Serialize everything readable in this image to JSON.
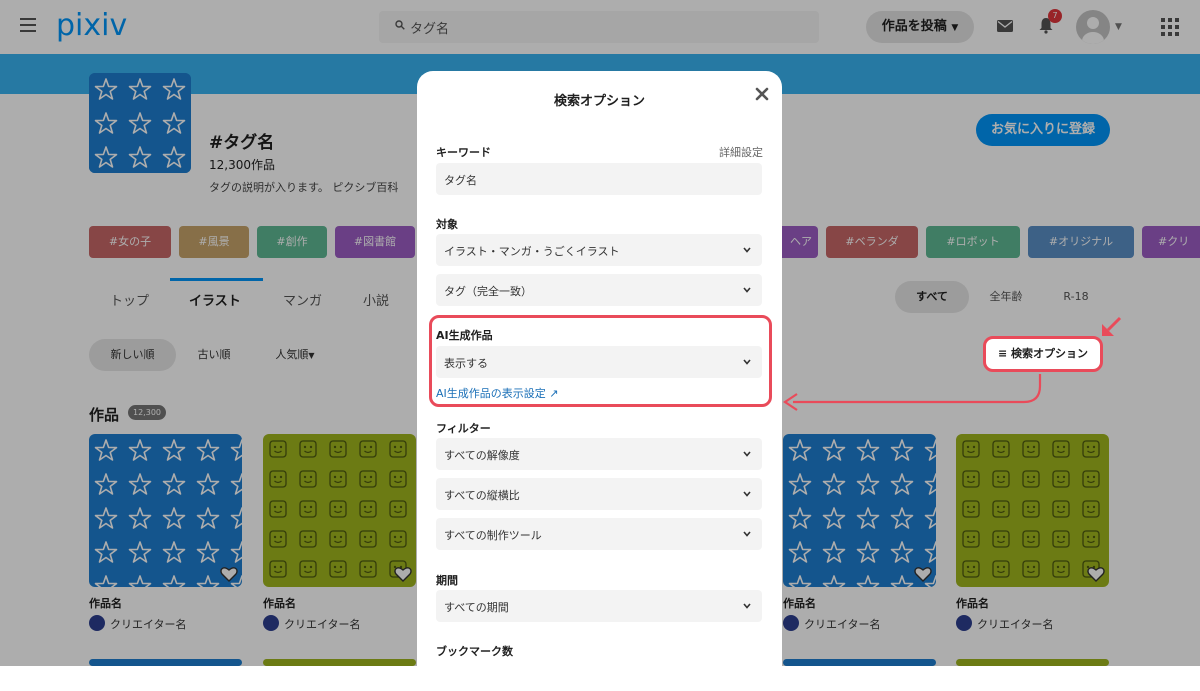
{
  "header": {
    "logo": "pixiv",
    "search_placeholder": "タグ名",
    "post_button": "作品を投稿",
    "notification_count": "7"
  },
  "tag": {
    "title": "#タグ名",
    "count": "12,300作品",
    "description": "タグの説明が入ります。 ピクシブ百科",
    "favorite_button": "お気に入りに登録"
  },
  "chips": [
    {
      "label": "#女の子",
      "color": "#c76868"
    },
    {
      "label": "#風景",
      "color": "#c8a46a"
    },
    {
      "label": "#創作",
      "color": "#5fb894"
    },
    {
      "label": "#図書館",
      "color": "#9c5ec4"
    },
    {
      "label": "ヘア",
      "color": "#9c5ec4"
    },
    {
      "label": "#ベランダ",
      "color": "#c76868"
    },
    {
      "label": "#ロボット",
      "color": "#5fb894"
    },
    {
      "label": "#オリジナル",
      "color": "#5b8fc6"
    },
    {
      "label": "#クリス",
      "color": "#9c5ec4"
    }
  ],
  "nav_tabs": [
    "トップ",
    "イラスト",
    "マンガ",
    "小説"
  ],
  "age_filters": [
    "すべて",
    "全年齢",
    "R-18"
  ],
  "sort_options": [
    "新しい順",
    "古い順",
    "人気順"
  ],
  "search_option_button": "検索オプション",
  "works": {
    "title": "作品",
    "count_badge": "12,300",
    "items": [
      {
        "name": "作品名",
        "creator": "クリエイター名"
      },
      {
        "name": "作品名",
        "creator": "クリエイター名"
      },
      {
        "name": "作品名",
        "creator": "クリエイター名"
      },
      {
        "name": "作品名",
        "creator": "クリエイター名"
      }
    ]
  },
  "modal": {
    "title": "検索オプション",
    "keyword_label": "キーワード",
    "detail_settings": "詳細設定",
    "keyword_value": "タグ名",
    "target_label": "対象",
    "target_value": "イラスト・マンガ・うごくイラスト",
    "match_value": "タグ（完全一致）",
    "ai_label": "AI生成作品",
    "ai_value": "表示する",
    "ai_link": "AI生成作品の表示設定",
    "filter_label": "フィルター",
    "resolution": "すべての解像度",
    "aspect_ratio": "すべての縦横比",
    "tool": "すべての制作ツール",
    "period_label": "期間",
    "period_value": "すべての期間",
    "bookmark_label": "ブックマーク数"
  },
  "colors": {
    "accent": "#0096fa",
    "highlight": "#e94b5a",
    "star_tile": "#1e7ed0",
    "smile_tile": "#9fb51e"
  }
}
